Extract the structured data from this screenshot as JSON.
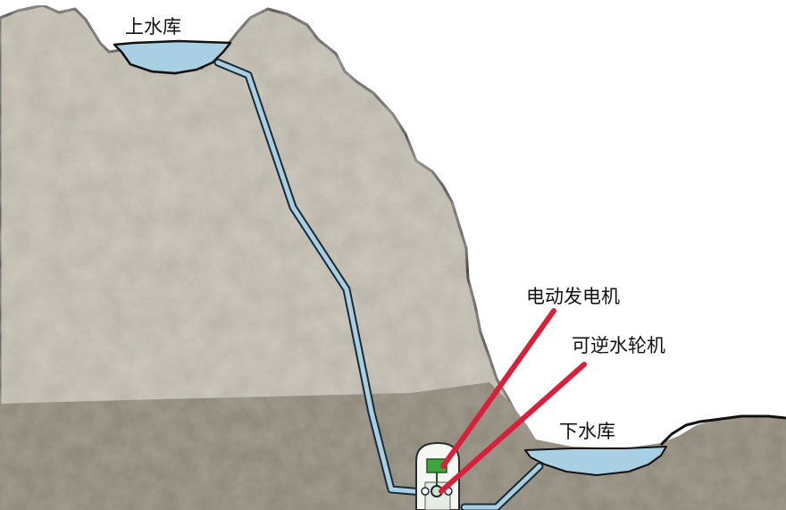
{
  "labels": {
    "upper_reservoir": "上水库",
    "motor_generator": "电动发电机",
    "reversible_turbine": "可逆水轮机",
    "lower_reservoir": "下水库"
  },
  "colors": {
    "rock": "#b8b2a6",
    "rock_outline": "#111111",
    "ground": "#8a8476",
    "water": "#a9cfe4",
    "pipe": "#a9cfe4",
    "pointer": "#d8203a",
    "machine_green": "#3ea53e",
    "powerhouse": "#f4f7f2"
  }
}
